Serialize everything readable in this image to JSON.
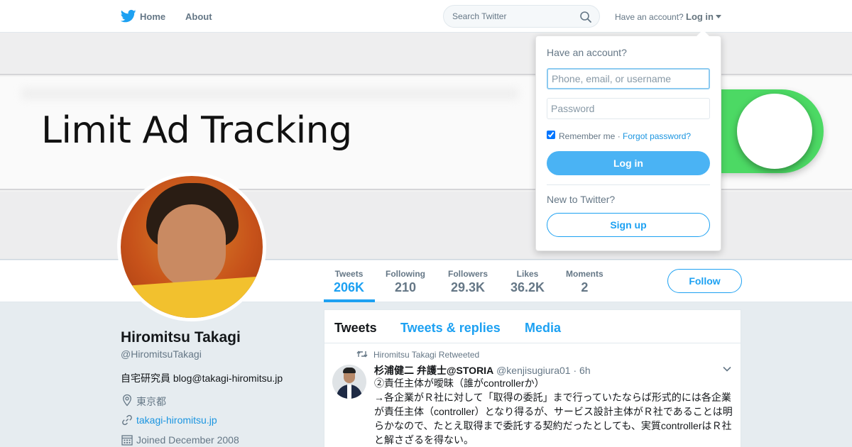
{
  "nav": {
    "home_label": "Home",
    "about_label": "About",
    "search_placeholder": "Search Twitter",
    "have_account_text": "Have an account?",
    "login_label": "Log in"
  },
  "banner": {
    "text": "Limit Ad Tracking",
    "toggle_color": "#4cd964"
  },
  "stats": [
    {
      "label": "Tweets",
      "value": "206K",
      "active": true
    },
    {
      "label": "Following",
      "value": "210"
    },
    {
      "label": "Followers",
      "value": "29.3K"
    },
    {
      "label": "Likes",
      "value": "36.2K"
    },
    {
      "label": "Moments",
      "value": "2"
    }
  ],
  "follow_button_label": "Follow",
  "profile": {
    "name": "Hiromitsu Takagi",
    "handle": "@HiromitsuTakagi",
    "bio": "自宅研究員 blog@takagi-hiromitsu.jp",
    "location": "東京都",
    "website": "takagi-hiromitsu.jp",
    "joined": "Joined December 2008",
    "location_icon": "location-pin-icon",
    "website_icon": "link-icon",
    "joined_icon": "calendar-icon"
  },
  "timeline": {
    "tabs": [
      {
        "label": "Tweets",
        "active": true
      },
      {
        "label": "Tweets & replies"
      },
      {
        "label": "Media"
      }
    ],
    "tweet": {
      "retweet_context": "Hiromitsu Takagi Retweeted",
      "author_name": "杉浦健二 弁護士@STORIA",
      "author_handle": "@kenjisugiura01",
      "time": "6h",
      "lines": [
        "②責任主体が曖昧（誰がcontrollerか）",
        "→各企業がＲ社に対して「取得の委託」まで行っていたならば形式的には各企業",
        "が責任主体（controller）となり得るが、サービス設計主体がＲ社であることは明",
        "らかなので、たとえ取得まで委託する契約だったとしても、実質controllerはＲ社",
        "と解さざるを得ない。"
      ]
    }
  },
  "login_dropdown": {
    "title": "Have an account?",
    "username_placeholder": "Phone, email, or username",
    "password_placeholder": "Password",
    "remember_label": "Remember me",
    "separator": "·",
    "forgot_label": "Forgot password?",
    "login_button": "Log in",
    "new_text": "New to Twitter?",
    "signup_button": "Sign up"
  },
  "colors": {
    "brand_blue": "#1da1f2",
    "login_button_blue": "#4ab3f4",
    "background": "#e6ecf0"
  }
}
